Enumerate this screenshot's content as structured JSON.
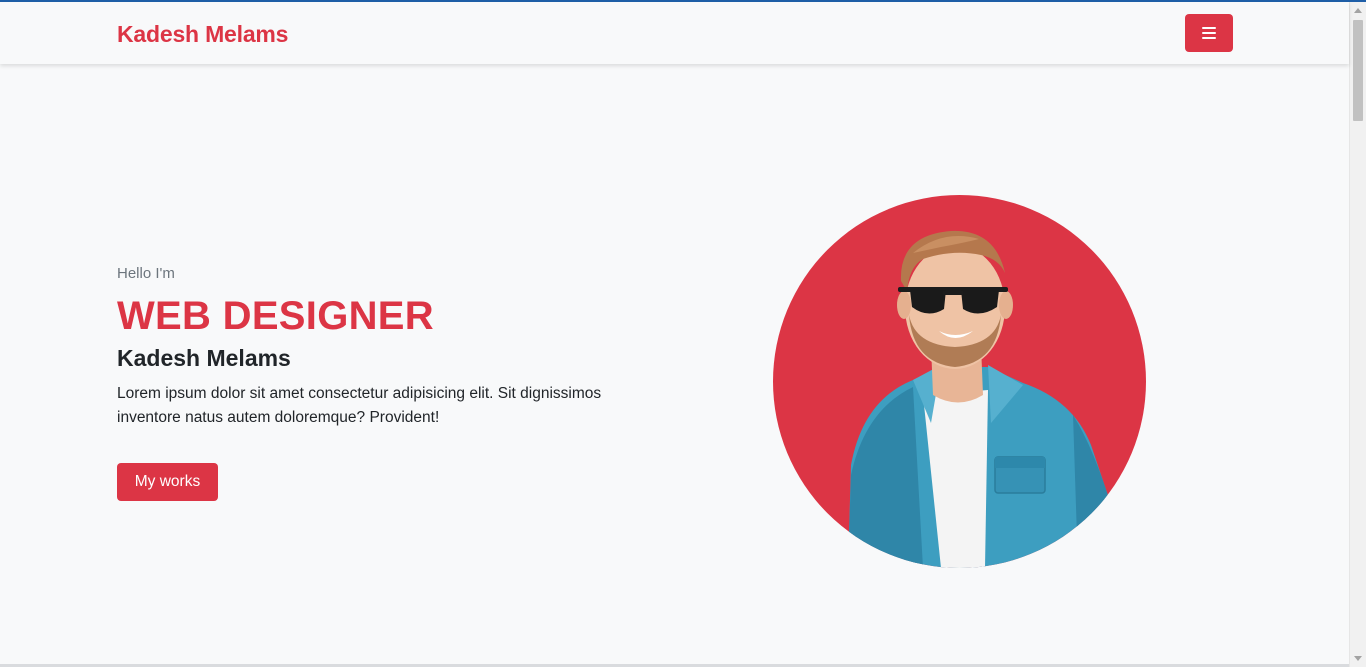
{
  "navbar": {
    "brand": "Kadesh Melams",
    "menu_icon": "hamburger-menu-icon"
  },
  "hero": {
    "greeting": "Hello I'm",
    "role": "WEB DESIGNER",
    "name": "Kadesh Melams",
    "description": "Lorem ipsum dolor sit amet consectetur adipisicing elit. Sit dignissimos inventore natus autem doloremque? Provident!",
    "cta_label": "My works"
  },
  "colors": {
    "accent": "#dc3545",
    "background": "#f8f9fa",
    "text": "#212529",
    "muted": "#6c757d"
  }
}
